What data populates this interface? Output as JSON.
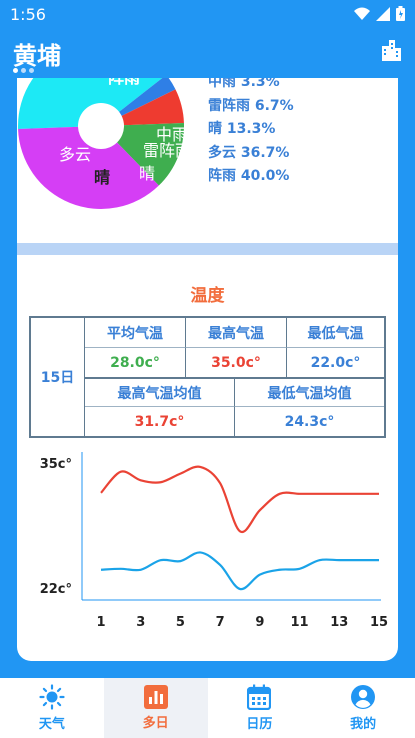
{
  "status": {
    "time": "1:56"
  },
  "appbar": {
    "title": "黄埔"
  },
  "pie": {
    "labels": {
      "top": "阵雨",
      "zhongyu": "中雨",
      "leizhenyu": "雷阵雨",
      "duoyun": "多云",
      "qing1": "晴",
      "qing2": "晴"
    },
    "legend": [
      "中雨 3.3%",
      "雷阵雨 6.7%",
      "晴 13.3%",
      "多云 36.7%",
      "阵雨 40.0%"
    ],
    "colors": {
      "zhenyu": "#1de9f5",
      "zhongyu": "#2f7fe6",
      "leizhenyu": "#ee3b30",
      "qing": "#3fae4f",
      "duoyun": "#d53ef5"
    }
  },
  "temperature": {
    "title": "温度",
    "day": "15日",
    "avg_label": "平均气温",
    "avg_value": "28.0c°",
    "max_label": "最高气温",
    "max_value": "35.0c°",
    "min_label": "最低气温",
    "min_value": "22.0c°",
    "max_avg_label": "最高气温均值",
    "max_avg_value": "31.7c°",
    "min_avg_label": "最低气温均值",
    "min_avg_value": "24.3c°"
  },
  "chart_data": {
    "type": "line",
    "x": [
      1,
      2,
      3,
      4,
      5,
      6,
      7,
      8,
      9,
      10,
      11,
      12,
      13,
      14,
      15
    ],
    "x_tick_labels": [
      "1",
      "3",
      "5",
      "7",
      "9",
      "11",
      "13",
      "15"
    ],
    "y_tick_labels": [
      "35c°",
      "22c°"
    ],
    "ylim": [
      22,
      35
    ],
    "series": [
      {
        "values": [
          32,
          34.2,
          33.3,
          33.1,
          34.0,
          34.7,
          33.0,
          28.0,
          30.2,
          31.9,
          31.9,
          31.9,
          31.9,
          31.9,
          31.9
        ],
        "color": "#ea4335"
      },
      {
        "values": [
          24,
          24.1,
          24.0,
          25.0,
          24.9,
          25.8,
          24.5,
          22.0,
          23.5,
          24.0,
          24.1,
          25.0,
          25.0,
          25.0,
          25.0
        ],
        "color": "#1aa3e8"
      }
    ]
  },
  "tabs": [
    {
      "label": "天气",
      "icon": "sun-icon"
    },
    {
      "label": "多日",
      "icon": "bar-chart-icon"
    },
    {
      "label": "日历",
      "icon": "calendar-icon"
    },
    {
      "label": "我的",
      "icon": "user-icon"
    }
  ]
}
